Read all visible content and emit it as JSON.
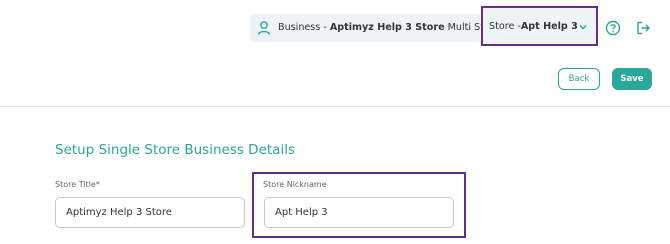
{
  "header": {
    "business_prefix": "Business - ",
    "business_name": "Aptimyz Help 3 Store",
    "business_type": " Multi Store - ",
    "store_prefix": "Store - ",
    "store_name": "Apt Help 3",
    "icons": {
      "user": "user-icon",
      "chevron": "chevron-down-icon",
      "help": "help-icon",
      "logout": "logout-icon"
    }
  },
  "actions": {
    "back_label": "Back",
    "save_label": "Save"
  },
  "form": {
    "title": "Setup Single Store Business Details",
    "store_title": {
      "label": "Store Title*",
      "value": "Aptimyz Help 3 Store"
    },
    "store_nickname": {
      "label": "Store Nickname",
      "value": "Apt Help 3"
    }
  },
  "colors": {
    "accent": "#2aa79b",
    "highlight": "#6a2c8c",
    "pill_bg": "#eef3f6"
  }
}
